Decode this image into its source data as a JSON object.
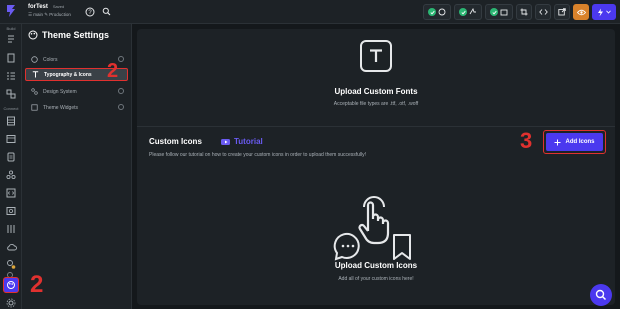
{
  "topbar": {
    "project_name": "forTest",
    "saved_label": "Saved",
    "branch_label": "☰ main  ✎ Production"
  },
  "rail": {
    "build_label": "Build",
    "connect_label": "Connect"
  },
  "settings": {
    "title": "Theme Settings",
    "items": [
      {
        "label": "Colors"
      },
      {
        "label": "Typography & Icons"
      },
      {
        "label": "Design System"
      },
      {
        "label": "Theme Widgets"
      }
    ]
  },
  "fonts": {
    "title": "Upload Custom Fonts",
    "subtitle": "Acceptable file types are .ttf, .otf, .woff"
  },
  "icons": {
    "title": "Custom Icons",
    "tutorial_label": "Tutorial",
    "description": "Please follow our tutorial on how to create your custom icons in order to upload them successfully!",
    "add_button_label": "Add Icons",
    "upload_title": "Upload Custom Icons",
    "upload_subtitle": "Add all of your custom icons here!"
  },
  "annotations": {
    "step_settings_item": "2",
    "step_rail": "2",
    "step_add_button": "3"
  },
  "colors": {
    "accent": "#4b39ef",
    "annotation": "#e0312f",
    "success": "#2bb673",
    "warning": "#d9822b"
  }
}
